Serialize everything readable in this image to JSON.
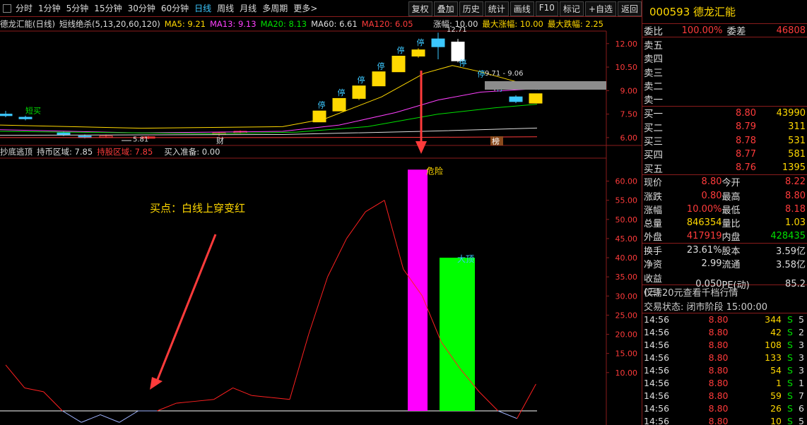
{
  "toolbar": {
    "periods": [
      "分时",
      "1分钟",
      "5分钟",
      "15分钟",
      "30分钟",
      "60分钟",
      "日线",
      "周线",
      "月线",
      "多周期",
      "更多>"
    ],
    "active_index": 6,
    "tools": [
      "复权",
      "叠加",
      "历史",
      "统计",
      "画线",
      "F10",
      "标记",
      "+自选",
      "返回"
    ]
  },
  "main_indicator": {
    "stock_title": "德龙汇能(日线)",
    "formula": "短线绝杀(5,13,20,60,120)",
    "ma5": "MA5: 9.21",
    "ma13": "MA13: 9.13",
    "ma20": "MA20: 8.13",
    "ma60": "MA60: 6.61",
    "ma120": "MA120: 6.05",
    "zhangfu": "涨幅: 10.00",
    "max_up": "最大涨幅: 10.00",
    "max_down": "最大跌幅: 2.25"
  },
  "sub_indicator": {
    "name": "抄底逃顶",
    "hold_zone": "持币区域: 7.85",
    "hold_stock": "持股区域: 7.85",
    "buy_prepare": "买入准备: 0.00"
  },
  "chart_data": [
    {
      "type": "candlestick",
      "y_ticks": [
        "12.00",
        "10.50",
        "9.00",
        "7.50",
        "6.00"
      ],
      "ylim": [
        5.5,
        12.8
      ],
      "annotations": [
        "短买",
        "5.81",
        "12.71",
        "9.71 - 9.06",
        "财",
        "榜"
      ],
      "limit_up_label": "停"
    },
    {
      "type": "bar",
      "y_ticks": [
        "60.00",
        "55.00",
        "50.00",
        "45.00",
        "40.00",
        "35.00",
        "30.00",
        "25.00",
        "20.00",
        "15.00",
        "10.00"
      ],
      "ylim": [
        0,
        66
      ],
      "bars": [
        {
          "label": "危险",
          "value": 63,
          "color": "#ff00ff"
        },
        {
          "label": "大顶",
          "value": 40,
          "color": "#00ff00"
        }
      ],
      "line_values": [
        12,
        6,
        5,
        0,
        -3,
        -1,
        -3,
        0,
        0,
        2,
        2.5,
        3,
        6,
        4,
        3.5,
        3,
        20,
        35,
        45,
        52,
        55,
        37,
        30,
        18,
        11,
        5,
        0,
        -2,
        7
      ],
      "annotation": "买点：白线上穿变红"
    }
  ],
  "quote": {
    "code_name": "000593 德龙汇能",
    "weibi_label": "委比",
    "weibi": "100.00%",
    "weicha_label": "委差",
    "weicha": "46808",
    "sell": [
      {
        "label": "卖五",
        "price": "",
        "qty": ""
      },
      {
        "label": "卖四",
        "price": "",
        "qty": ""
      },
      {
        "label": "卖三",
        "price": "",
        "qty": ""
      },
      {
        "label": "卖二",
        "price": "",
        "qty": ""
      },
      {
        "label": "卖一",
        "price": "",
        "qty": ""
      }
    ],
    "buy": [
      {
        "label": "买一",
        "price": "8.80",
        "qty": "43990"
      },
      {
        "label": "买二",
        "price": "8.79",
        "qty": "311"
      },
      {
        "label": "买三",
        "price": "8.78",
        "qty": "531"
      },
      {
        "label": "买四",
        "price": "8.77",
        "qty": "581"
      },
      {
        "label": "买五",
        "price": "8.76",
        "qty": "1395"
      }
    ],
    "stats": [
      [
        "现价",
        "8.80",
        "今开",
        "8.22"
      ],
      [
        "涨跌",
        "0.80",
        "最高",
        "8.80"
      ],
      [
        "涨幅",
        "10.00%",
        "最低",
        "8.18"
      ],
      [
        "总量",
        "846354",
        "量比",
        "1.03"
      ],
      [
        "外盘",
        "417919",
        "内盘",
        "428435"
      ]
    ],
    "stats2": [
      [
        "换手",
        "23.61%",
        "股本",
        "3.59亿"
      ],
      [
        "净资",
        "2.99",
        "流通",
        "3.58亿"
      ],
      [
        "收益(三)",
        "0.050",
        "PE(动)",
        "85.2"
      ]
    ],
    "promo": "仅需20元查看千档行情",
    "trade_status": "交易状态: 闭市阶段 15:00:00",
    "ticks": [
      [
        "14:56",
        "8.80",
        "344",
        "S",
        "5"
      ],
      [
        "14:56",
        "8.80",
        "42",
        "S",
        "2"
      ],
      [
        "14:56",
        "8.80",
        "108",
        "S",
        "3"
      ],
      [
        "14:56",
        "8.80",
        "133",
        "S",
        "3"
      ],
      [
        "14:56",
        "8.80",
        "54",
        "S",
        "3"
      ],
      [
        "14:56",
        "8.80",
        "1",
        "S",
        "1"
      ],
      [
        "14:56",
        "8.80",
        "59",
        "S",
        "7"
      ],
      [
        "14:56",
        "8.80",
        "26",
        "S",
        "6"
      ],
      [
        "14:56",
        "8.80",
        "10",
        "S",
        "5"
      ]
    ]
  }
}
